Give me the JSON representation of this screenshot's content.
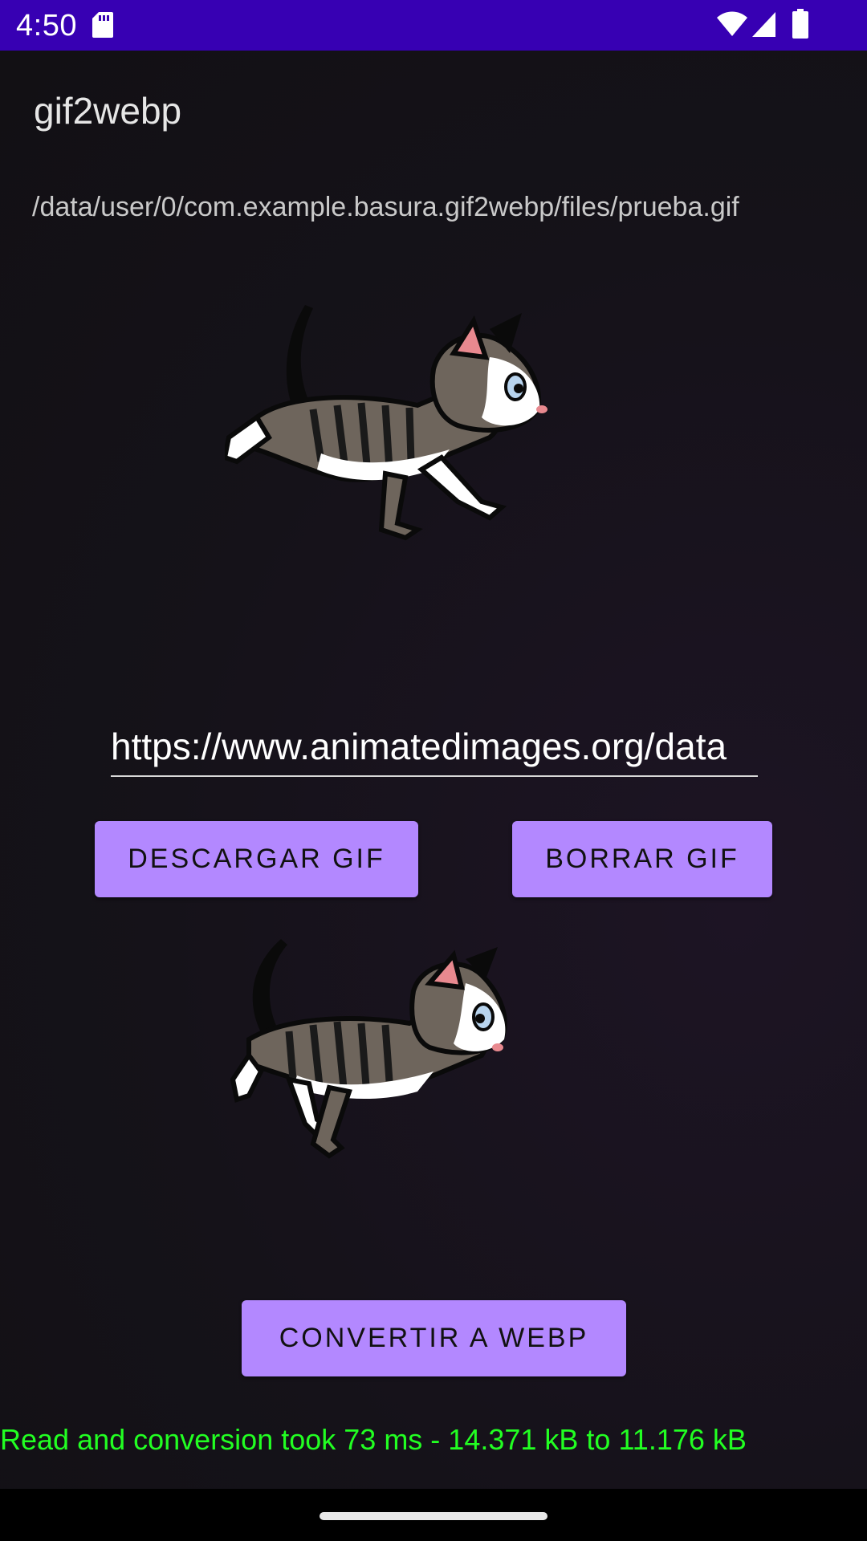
{
  "status_bar": {
    "time": "4:50",
    "icons": [
      "sd-card-icon",
      "wifi-icon",
      "cell-signal-icon",
      "battery-icon"
    ],
    "background": "#3700b3"
  },
  "app": {
    "title": "gif2webp",
    "file_path": "/data/user/0/com.example.basura.gif2webp/files/prueba.gif"
  },
  "url_input": {
    "value": "https://www.animatedimages.org/data"
  },
  "buttons": {
    "download": "DESCARGAR GIF",
    "delete": "BORRAR GIF",
    "convert": "CONVERTIR A WEBP"
  },
  "result": {
    "text": "Read and conversion took 73 ms - 14.371 kB to 11.176 kB",
    "color": "#22ff22"
  },
  "colors": {
    "accent": "#b388ff",
    "background": "#121016"
  }
}
